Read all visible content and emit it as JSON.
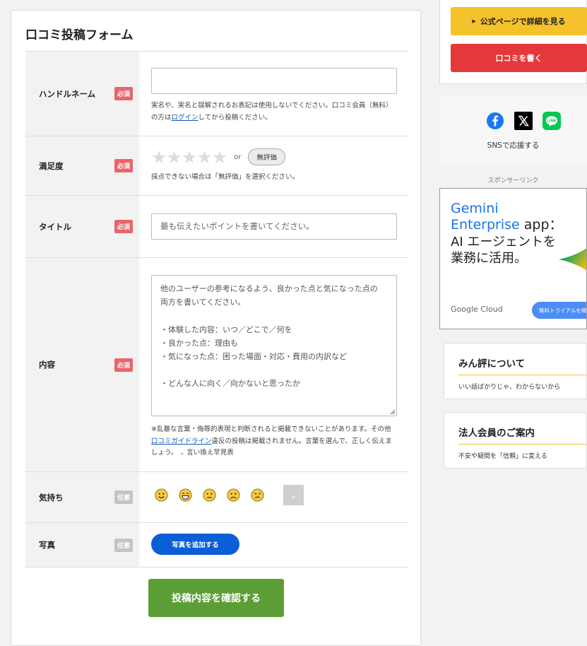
{
  "form": {
    "title": "口コミ投稿フォーム",
    "required_badge": "必須",
    "optional_badge": "任意",
    "handle": {
      "label": "ハンドルネーム",
      "value": "",
      "note_pre": "実名や、実名と誤解されるお表記は使用しないでください。口コミ会員（無料）",
      "note_mid_pre": "の方は",
      "note_link": "ログイン",
      "note_post": "してから投稿ください。"
    },
    "satisfaction": {
      "label": "満足度",
      "stars_filled": 0,
      "stars_total": 5,
      "or": "or",
      "no_eval": "無評価",
      "note": "採点できない場合は「無評価」を選択ください。"
    },
    "title_field": {
      "label": "タイトル",
      "placeholder": "最も伝えたいポイントを書いてください。"
    },
    "content": {
      "label": "内容",
      "placeholder_lines": [
        "他のユーザーの参考になるよう、良かった点と気になった点の",
        "両方を書いてください。",
        "",
        "・体験した内容：いつ／どこで／何を",
        "・良かった点：理由も",
        "・気になった点：困った場面・対応・費用の内訳など",
        "",
        "・どんな人に向く／向かないと思ったか"
      ],
      "note_line1": "※乱暴な言葉・侮辱的表現と判断されると掲載できないことがあります。その他",
      "note_link": "口コミガイドライン",
      "note_line2": "違反の投稿は掲載されません。言葉を選んで、正しく伝えま",
      "note_line3": "しょう。",
      "note_toggle": "言い換え早見表"
    },
    "feeling": {
      "label": "気持ち",
      "emojis": [
        "smiley-icon",
        "grin-icon",
        "neutral-icon",
        "frown-icon",
        "tired-icon"
      ]
    },
    "photo": {
      "label": "写真",
      "button": "写真を追加する"
    },
    "submit": "投稿内容を確認する"
  },
  "sidebar": {
    "official_button": "公式ページで詳細を見る",
    "write_button": "口コミを書く",
    "sns_label": "SNSで応援する",
    "sponsor_label": "スポンサーリンク",
    "ad": {
      "line1": "Gemini",
      "line2a": "Enterprise",
      "line2b": " app：",
      "line3": "AI エージェントを",
      "line4": "業務に活用。",
      "brand": "Google Cloud",
      "cta": "無料トライアルを開"
    },
    "cards": [
      {
        "title": "みん評について",
        "subtitle": "いい話ばかりじゃ、わからないから"
      },
      {
        "title": "法人会員のご案内",
        "subtitle": "不安や疑問を「信頼」に変える"
      }
    ]
  },
  "colors": {
    "required": "#e8656b",
    "optional": "#c4c4c4",
    "primary_blue": "#0a5ed6",
    "submit_green": "#5a9e35",
    "official_yellow": "#f5c22c",
    "write_red": "#e5383a"
  }
}
